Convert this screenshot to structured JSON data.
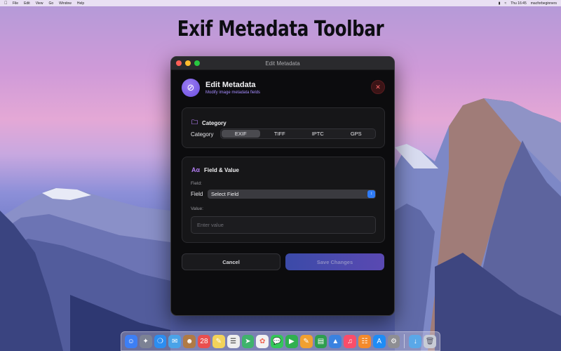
{
  "menubar": {
    "items": [
      "File",
      "Edit",
      "View",
      "Go",
      "Window",
      "Help"
    ],
    "clock": "Thu 16:45",
    "user": "macforbeginners"
  },
  "page": {
    "title": "Exif Metadata Toolbar"
  },
  "window": {
    "title": "Edit Metadata"
  },
  "header": {
    "title": "Edit Metadata",
    "subtitle": "Modify image metadata fields"
  },
  "category": {
    "title": "Category",
    "label": "Category",
    "segments": [
      "EXIF",
      "TIFF",
      "IPTC",
      "GPS"
    ],
    "selected": "EXIF"
  },
  "field_value": {
    "title": "Field & Value",
    "field_small_label": "Field:",
    "field_label": "Field",
    "select_value": "Select Field",
    "value_small_label": "Value:",
    "value_placeholder": "Enter value"
  },
  "buttons": {
    "cancel": "Cancel",
    "save": "Save Changes"
  },
  "colors": {
    "accent": "#6b4fe0",
    "close": "#ff6a6a",
    "select_chevron": "#2f7bf5",
    "save_gradient_start": "#3b4aa8",
    "save_gradient_end": "#5a49b2"
  }
}
